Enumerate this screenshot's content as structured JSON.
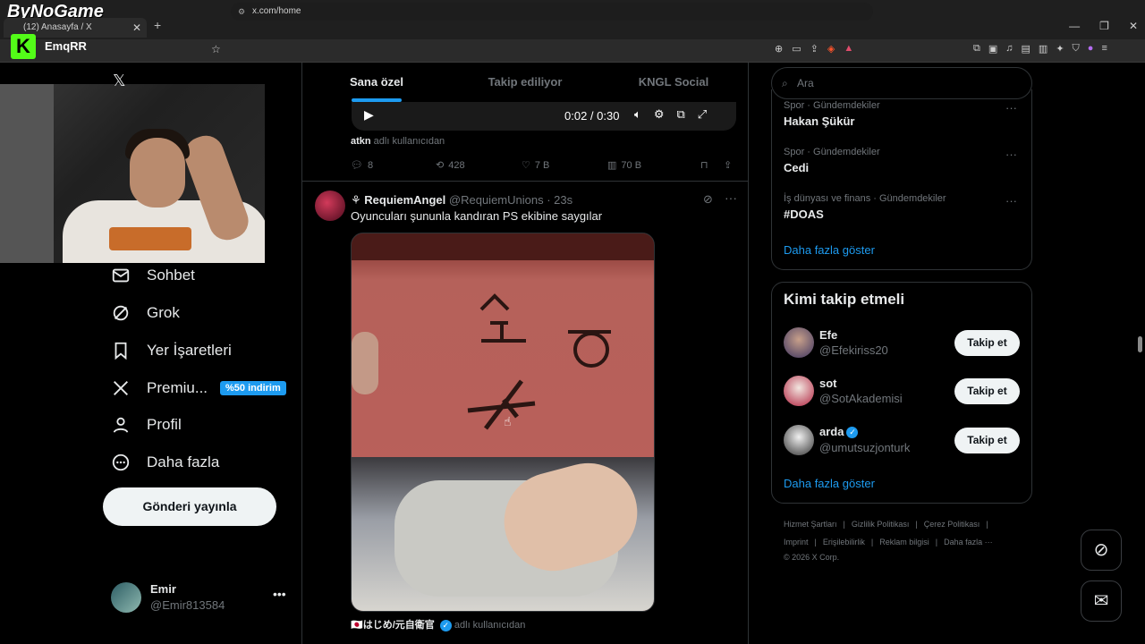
{
  "browser": {
    "overlay_logo": "ByNoGame",
    "tab_title": "(12) Anasayfa / X",
    "new_tab": "+",
    "url": "x.com/home",
    "streamer": "EmqRR",
    "window_controls": [
      "—",
      "❐",
      "✕"
    ]
  },
  "nav": {
    "items": [
      {
        "label": "Sohbet",
        "icon": "mail-icon"
      },
      {
        "label": "Grok",
        "icon": "grok-icon"
      },
      {
        "label": "Yer İşaretleri",
        "icon": "bookmark-icon"
      },
      {
        "label": "Premiu...",
        "icon": "x-icon",
        "badge": "%50 indirim"
      },
      {
        "label": "Profil",
        "icon": "person-icon"
      },
      {
        "label": "Daha fazla",
        "icon": "more-circle-icon"
      }
    ],
    "post_button": "Gönderi yayınla",
    "profile": {
      "name": "Emir",
      "handle": "@Emir813584"
    }
  },
  "tabs": [
    {
      "label": "Sana özel",
      "active": true
    },
    {
      "label": "Takip ediliyor",
      "active": false
    },
    {
      "label": "KNGL Social",
      "active": false
    }
  ],
  "tweet1": {
    "video_time": "0:02 / 0:30",
    "via_user": "atkn",
    "via_suffix": " adlı kullanıcıdan",
    "replies": "8",
    "reposts": "428",
    "likes": "7 B",
    "views": "70 B"
  },
  "tweet2": {
    "display_name": "⚘ RequiemAngel",
    "handle": "@RequiemUnions",
    "time": "· 23s",
    "text": "Oyuncuları şununla kandıran PS ekibine saygılar",
    "via_user": "🇯🇵はじめ/元自衛官",
    "via_suffix": " adlı kullanıcıdan"
  },
  "search": {
    "placeholder": "Ara"
  },
  "trends": [
    {
      "category": "Spor · Gündemdekiler",
      "name": "Hakan Şükür"
    },
    {
      "category": "Spor · Gündemdekiler",
      "name": "Cedi"
    },
    {
      "category": "İş dünyası ve finans · Gündemdekiler",
      "name": "#DOAS"
    }
  ],
  "trends_show_more": "Daha fazla göster",
  "who_to_follow": {
    "title": "Kimi takip etmeli",
    "users": [
      {
        "name": "Efe",
        "handle": "@Efekiriss20",
        "button": "Takip et",
        "color": "#5a4a8a"
      },
      {
        "name": "sot",
        "handle": "@SotAkademisi",
        "button": "Takip et",
        "color": "#b0223f"
      },
      {
        "name": "arda",
        "handle": "@umutsuzjonturk",
        "button": "Takip et",
        "color": "#cfcfcf",
        "verified": true
      }
    ],
    "show_more": "Daha fazla göster"
  },
  "footer": {
    "row1": [
      "Hizmet Şartları",
      "|",
      "Gizlilik Politikası",
      "|",
      "Çerez Politikası",
      "|"
    ],
    "row2": [
      "Imprint",
      "|",
      "Erişilebilirlik",
      "|",
      "Reklam bilgisi",
      "|",
      "Daha fazla ···"
    ],
    "copyright": "© 2026 X Corp."
  }
}
